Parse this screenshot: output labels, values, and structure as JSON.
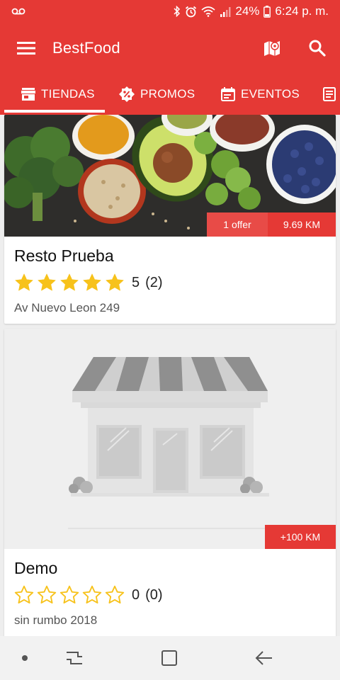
{
  "status_bar": {
    "battery_percent": "24%",
    "time": "6:24 p. m.",
    "icons": [
      "voicemail-icon",
      "bluetooth-icon",
      "alarm-icon",
      "wifi-icon",
      "signal-icon",
      "battery-icon"
    ]
  },
  "app_bar": {
    "title": "BestFood",
    "actions": [
      "map-icon",
      "search-icon"
    ]
  },
  "tabs": [
    {
      "label": "TIENDAS",
      "icon": "store-icon",
      "selected": true
    },
    {
      "label": "PROMOS",
      "icon": "promo-badge-icon",
      "selected": false
    },
    {
      "label": "EVENTOS",
      "icon": "calendar-icon",
      "selected": false
    },
    {
      "label": "",
      "icon": "list-icon",
      "selected": false
    }
  ],
  "stores": [
    {
      "name": "Resto Prueba",
      "rating": "5",
      "rating_count": "(2)",
      "stars_filled": 5,
      "address": "Av Nuevo Leon 249",
      "offer_badge": "1 offer",
      "distance": "9.69 KM",
      "image": "food-bowls-photo"
    },
    {
      "name": "Demo",
      "rating": "0",
      "rating_count": "(0)",
      "stars_filled": 0,
      "address": "sin rumbo 2018",
      "distance": "+100 KM",
      "image": "storefront-placeholder"
    }
  ],
  "colors": {
    "primary": "#e53935",
    "star": "#f7c21b",
    "nav_bar": "#f2f2f2"
  },
  "nav_bar": [
    "dot-icon",
    "recents-icon",
    "home-icon",
    "back-icon"
  ]
}
